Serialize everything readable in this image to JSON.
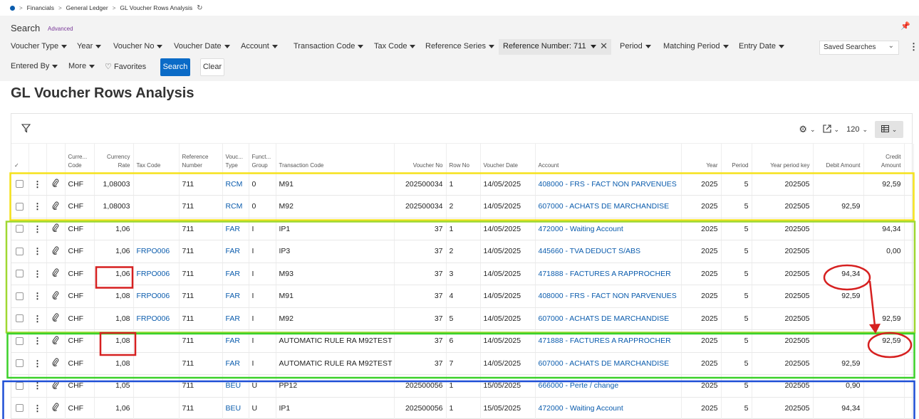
{
  "breadcrumb": {
    "items": [
      "Financials",
      "General Ledger",
      "GL Voucher Rows Analysis"
    ]
  },
  "search": {
    "title": "Search",
    "advanced_label": "Advanced",
    "filters": [
      "Voucher Type",
      "Year",
      "Voucher No",
      "Voucher Date",
      "Account",
      "Transaction Code",
      "Tax Code",
      "Reference Series"
    ],
    "active_filter": "Reference Number: 711",
    "filters_after": [
      "Period",
      "Matching Period",
      "Entry Date"
    ],
    "saved_searches": "Saved Searches",
    "row2": {
      "entered_by": "Entered By",
      "more": "More",
      "favorites": "Favorites",
      "search_button": "Search",
      "clear_button": "Clear"
    }
  },
  "page_title": "GL Voucher Rows Analysis",
  "toolbar": {
    "page_size": "120"
  },
  "columns": [
    {
      "l1": "",
      "l2": ""
    },
    {
      "l1": "",
      "l2": ""
    },
    {
      "l1": "",
      "l2": ""
    },
    {
      "l1": "Curre...",
      "l2": "Code"
    },
    {
      "l1": "Currency",
      "l2": "Rate"
    },
    {
      "l1": "",
      "l2": "Tax Code"
    },
    {
      "l1": "Reference",
      "l2": "Number"
    },
    {
      "l1": "Vouc...",
      "l2": "Type"
    },
    {
      "l1": "Funct...",
      "l2": "Group"
    },
    {
      "l1": "",
      "l2": "Transaction Code"
    },
    {
      "l1": "",
      "l2": "Voucher No"
    },
    {
      "l1": "",
      "l2": "Row No"
    },
    {
      "l1": "",
      "l2": "Voucher Date"
    },
    {
      "l1": "",
      "l2": "Account"
    },
    {
      "l1": "",
      "l2": "Year"
    },
    {
      "l1": "",
      "l2": "Period"
    },
    {
      "l1": "",
      "l2": "Year period key"
    },
    {
      "l1": "",
      "l2": "Debit Amount"
    },
    {
      "l1": "Credit",
      "l2": "Amount"
    }
  ],
  "rows": [
    {
      "cur": "CHF",
      "rate": "1,08003",
      "tax": "",
      "ref": "711",
      "vtype": "RCM",
      "fgroup": "0",
      "tcode": "M91",
      "vno": "202500034",
      "rowno": "1",
      "vdate": "14/05/2025",
      "account": "408000 - FRS - FACT NON PARVENUES",
      "year": "2025",
      "period": "5",
      "ypk": "202505",
      "debit": "",
      "credit": "92,59"
    },
    {
      "cur": "CHF",
      "rate": "1,08003",
      "tax": "",
      "ref": "711",
      "vtype": "RCM",
      "fgroup": "0",
      "tcode": "M92",
      "vno": "202500034",
      "rowno": "2",
      "vdate": "14/05/2025",
      "account": "607000 - ACHATS DE MARCHANDISE",
      "year": "2025",
      "period": "5",
      "ypk": "202505",
      "debit": "92,59",
      "credit": ""
    },
    {
      "cur": "CHF",
      "rate": "1,06",
      "tax": "",
      "ref": "711",
      "vtype": "FAR",
      "fgroup": "I",
      "tcode": "IP1",
      "vno": "37",
      "rowno": "1",
      "vdate": "14/05/2025",
      "account": "472000 - Waiting Account",
      "year": "2025",
      "period": "5",
      "ypk": "202505",
      "debit": "",
      "credit": "94,34"
    },
    {
      "cur": "CHF",
      "rate": "1,06",
      "tax": "FRPO006",
      "ref": "711",
      "vtype": "FAR",
      "fgroup": "I",
      "tcode": "IP3",
      "vno": "37",
      "rowno": "2",
      "vdate": "14/05/2025",
      "account": "445660 - TVA DEDUCT S/ABS",
      "year": "2025",
      "period": "5",
      "ypk": "202505",
      "debit": "",
      "credit": "0,00"
    },
    {
      "cur": "CHF",
      "rate": "1,06",
      "tax": "FRPO006",
      "ref": "711",
      "vtype": "FAR",
      "fgroup": "I",
      "tcode": "M93",
      "vno": "37",
      "rowno": "3",
      "vdate": "14/05/2025",
      "account": "471888 - FACTURES A RAPPROCHER",
      "year": "2025",
      "period": "5",
      "ypk": "202505",
      "debit": "94,34",
      "credit": ""
    },
    {
      "cur": "CHF",
      "rate": "1,08",
      "tax": "FRPO006",
      "ref": "711",
      "vtype": "FAR",
      "fgroup": "I",
      "tcode": "M91",
      "vno": "37",
      "rowno": "4",
      "vdate": "14/05/2025",
      "account": "408000 - FRS - FACT NON PARVENUES",
      "year": "2025",
      "period": "5",
      "ypk": "202505",
      "debit": "92,59",
      "credit": ""
    },
    {
      "cur": "CHF",
      "rate": "1,08",
      "tax": "FRPO006",
      "ref": "711",
      "vtype": "FAR",
      "fgroup": "I",
      "tcode": "M92",
      "vno": "37",
      "rowno": "5",
      "vdate": "14/05/2025",
      "account": "607000 - ACHATS DE MARCHANDISE",
      "year": "2025",
      "period": "5",
      "ypk": "202505",
      "debit": "",
      "credit": "92,59"
    },
    {
      "cur": "CHF",
      "rate": "1,08",
      "tax": "",
      "ref": "711",
      "vtype": "FAR",
      "fgroup": "I",
      "tcode": "AUTOMATIC RULE RA M92TEST",
      "vno": "37",
      "rowno": "6",
      "vdate": "14/05/2025",
      "account": "471888 - FACTURES A RAPPROCHER",
      "year": "2025",
      "period": "5",
      "ypk": "202505",
      "debit": "",
      "credit": "92,59"
    },
    {
      "cur": "CHF",
      "rate": "1,08",
      "tax": "",
      "ref": "711",
      "vtype": "FAR",
      "fgroup": "I",
      "tcode": "AUTOMATIC RULE RA M92TEST",
      "vno": "37",
      "rowno": "7",
      "vdate": "14/05/2025",
      "account": "607000 - ACHATS DE MARCHANDISE",
      "year": "2025",
      "period": "5",
      "ypk": "202505",
      "debit": "92,59",
      "credit": ""
    },
    {
      "cur": "CHF",
      "rate": "1,05",
      "tax": "",
      "ref": "711",
      "vtype": "BEU",
      "fgroup": "U",
      "tcode": "PP12",
      "vno": "202500056",
      "rowno": "1",
      "vdate": "15/05/2025",
      "account": "666000 - Perte / change",
      "year": "2025",
      "period": "5",
      "ypk": "202505",
      "debit": "0,90",
      "credit": ""
    },
    {
      "cur": "CHF",
      "rate": "1,06",
      "tax": "",
      "ref": "711",
      "vtype": "BEU",
      "fgroup": "U",
      "tcode": "IP1",
      "vno": "202500056",
      "rowno": "1",
      "vdate": "15/05/2025",
      "account": "472000 - Waiting Account",
      "year": "2025",
      "period": "5",
      "ypk": "202505",
      "debit": "94,34",
      "credit": ""
    }
  ],
  "annotation_colors": {
    "yellow": "#f5e21a",
    "lime": "#9fd832",
    "green": "#3bd12a",
    "blue": "#1e4fd6",
    "red": "#d62020"
  }
}
